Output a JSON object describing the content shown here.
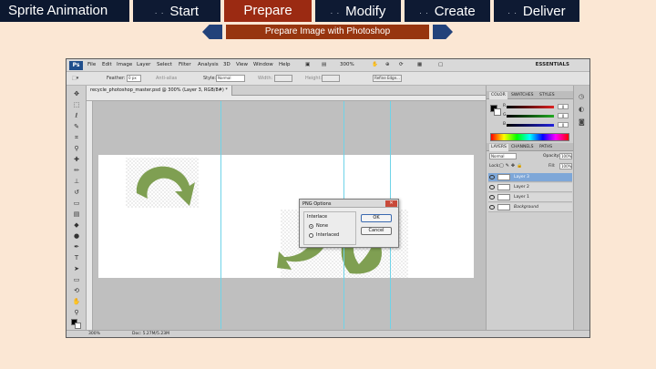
{
  "nav": {
    "brand": "Sprite Animation",
    "dots": ". .",
    "tabs": [
      {
        "label": "Start",
        "active": false
      },
      {
        "label": "Prepare",
        "active": true
      },
      {
        "label": "Modify",
        "active": false
      },
      {
        "label": "Create",
        "active": false
      },
      {
        "label": "Deliver",
        "active": false
      }
    ]
  },
  "subnav": {
    "title": "Prepare Image with Photoshop"
  },
  "colors": {
    "nav_bg": "#0e1a33",
    "active_tab": "#9b2a12",
    "subtitle_bg": "#97350f",
    "arrow": "#22427a",
    "page_bg": "#fbe7d4",
    "shape_green": "#7f9f52"
  },
  "photoshop": {
    "logo": "Ps",
    "menu": [
      "File",
      "Edit",
      "Image",
      "Layer",
      "Select",
      "Filter",
      "Analysis",
      "3D",
      "View",
      "Window",
      "Help"
    ],
    "zoom_menu": "300%",
    "workspace": "ESSENTIALS",
    "options": {
      "feather_label": "Feather:",
      "feather_value": "0 px",
      "antialias": "Anti-alias",
      "style_label": "Style:",
      "style_value": "Normal",
      "width_label": "Width:",
      "height_label": "Height:",
      "refine": "Refine Edge..."
    },
    "doc_tab": "recycle_photoshop_master.psd @ 300% (Layer 3, RGB/8#) *",
    "status": {
      "zoom": "300%",
      "doc": "Doc: 5.27M/5.23M"
    },
    "dialog": {
      "title": "PNG Options",
      "group_label": "Interlace",
      "options": [
        {
          "label": "None",
          "selected": true
        },
        {
          "label": "Interlaced",
          "selected": false
        }
      ],
      "ok": "OK",
      "cancel": "Cancel"
    },
    "panels": {
      "color_tabs": [
        "COLOR",
        "SWATCHES",
        "STYLES"
      ],
      "sliders": [
        {
          "channel": "R",
          "value": "0",
          "color": "#d22"
        },
        {
          "channel": "G",
          "value": "0",
          "color": "#2a2"
        },
        {
          "channel": "B",
          "value": "0",
          "color": "#22d"
        }
      ],
      "layer_tabs": [
        "LAYERS",
        "CHANNELS",
        "PATHS"
      ],
      "blend_mode": "Normal",
      "opacity_label": "Opacity:",
      "opacity": "100%",
      "lock_label": "Lock:",
      "fill_label": "Fill:",
      "fill": "100%",
      "layers": [
        {
          "name": "Layer 3",
          "selected": true
        },
        {
          "name": "Layer 2",
          "selected": false
        },
        {
          "name": "Layer 1",
          "selected": false
        },
        {
          "name": "Background",
          "selected": false
        }
      ]
    }
  }
}
